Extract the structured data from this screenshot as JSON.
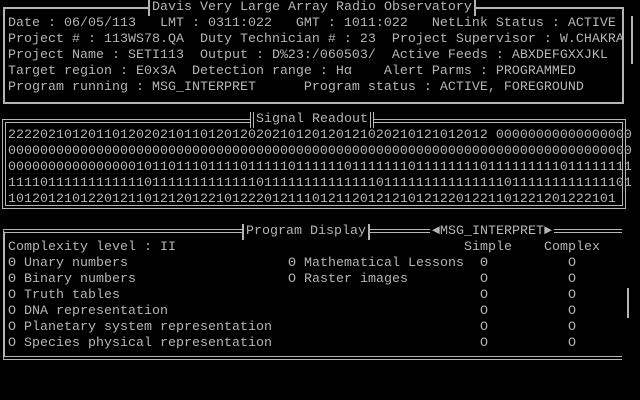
{
  "header": {
    "title": "Davis Very Large Array Radio Observatory",
    "rows": [
      "Date : 06/05/113   LMT : 0311:022   GMT : 1011:022   NetLink Status : ACTIVE",
      "Project # : 113WS78.QA  Duty Technician # : 23  Project Supervisor : W.CHAKRA",
      "Project Name : SETI113  Output : D%23:/060503/  Active Feeds : ABXDEFGXXJKL",
      "Target region : E0x3A  Detection range : Hα    Alert Parms : PROGRAMMED",
      "Program running : MSG_INTERPRET      Program status : ACTIVE, FOREGROUND"
    ]
  },
  "signal": {
    "title": "Signal Readout",
    "lines": [
      "222202101201101202021011012012020210120120121020210121012012 00000000000000000",
      "000000000000000000000000000000000000000000000000000000000000000000000000000000",
      "000000000000000010110111011110111110111111011111110111111110111111111011111111",
      "111101111111111110111111111111101111111111111101111111111111110111111111111101",
      "1012012101220121101212012210122201211101211201212101212201221101221201222101"
    ]
  },
  "program": {
    "title": "Program Display",
    "subtitle": "◄MSG_INTERPRET►",
    "complexity": "Complexity level : II",
    "col_simple": "Simple",
    "col_complex": "Complex",
    "items": [
      {
        "mark": "Θ",
        "label": "Unary numbers"
      },
      {
        "mark": "Θ",
        "label": "Binary numbers"
      },
      {
        "mark": "O",
        "label": "Truth tables"
      },
      {
        "mark": "O",
        "label": "DNA representation"
      },
      {
        "mark": "O",
        "label": "Planetary system representation"
      },
      {
        "mark": "O",
        "label": "Species physical representation"
      }
    ],
    "lessons": [
      {
        "mark": "Θ",
        "label": "Mathematical Lessons"
      },
      {
        "mark": "O",
        "label": "Raster images"
      }
    ],
    "simple": [
      "Θ",
      "O",
      "O",
      "O",
      "O",
      "O"
    ],
    "complex": [
      "O",
      "O",
      "O",
      "O",
      "O",
      "O"
    ]
  }
}
